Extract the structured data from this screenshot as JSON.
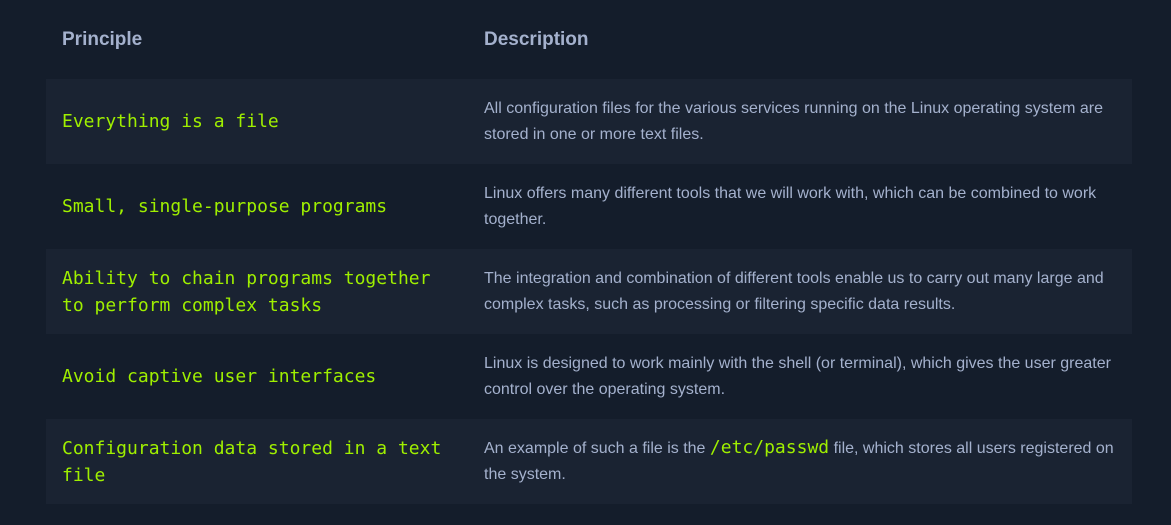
{
  "table": {
    "headers": {
      "principle": "Principle",
      "description": "Description"
    },
    "rows": [
      {
        "principle": "Everything is a file",
        "description": "All configuration files for the various services running on the Linux operating system are stored in one or more text files."
      },
      {
        "principle": "Small, single-purpose programs",
        "description": "Linux offers many different tools that we will work with, which can be combined to work together."
      },
      {
        "principle": "Ability to chain programs together to perform complex tasks",
        "description": "The integration and combination of different tools enable us to carry out many large and complex tasks, such as processing or filtering specific data results."
      },
      {
        "principle": "Avoid captive user interfaces",
        "description": "Linux is designed to work mainly with the shell (or terminal), which gives the user greater control over the operating system."
      },
      {
        "principle": "Configuration data stored in a text file",
        "description_before": "An example of such a file is the ",
        "description_code": "/etc/passwd",
        "description_after": " file, which stores all users registered on the system."
      }
    ]
  },
  "colors": {
    "background": "#141d2b",
    "row_alt": "#1a2332",
    "principle_text": "#9fef00",
    "body_text": "#a4b1cd"
  }
}
